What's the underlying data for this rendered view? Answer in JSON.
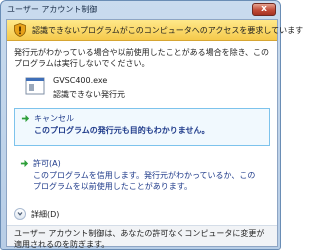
{
  "window": {
    "title": "ユーザー アカウント制御",
    "close_symbol": "x"
  },
  "banner": {
    "message": "認識できないプログラムがこのコンピュータへのアクセスを要求しています",
    "icon": "warning-shield-icon"
  },
  "intro": {
    "text": "発行元がわかっている場合や以前使用したことがある場合を除き、このプログラムは実行しないでください。"
  },
  "program": {
    "name": "GVSC400.exe",
    "publisher_status": "認識できない発行元",
    "icon": "application-icon"
  },
  "options": {
    "cancel": {
      "title": "キャンセル",
      "description": "このプログラムの発行元も目的もわかりません。"
    },
    "allow": {
      "title": "許可(A)",
      "description": "このプログラムを信用します。発行元がわかっているか、このプログラムを以前使用したことがあります。"
    }
  },
  "details": {
    "label": "詳細(D)"
  },
  "footer": {
    "text": "ユーザー アカウント制御は、あなたの許可なくコンピュータに変更が適用されるのを防ぎます。"
  },
  "colors": {
    "banner_bg": "#f5c94b",
    "link_blue": "#1e3a8a",
    "arrow_green": "#2e9f3a",
    "cancel_highlight_border": "#7dc3ec"
  }
}
